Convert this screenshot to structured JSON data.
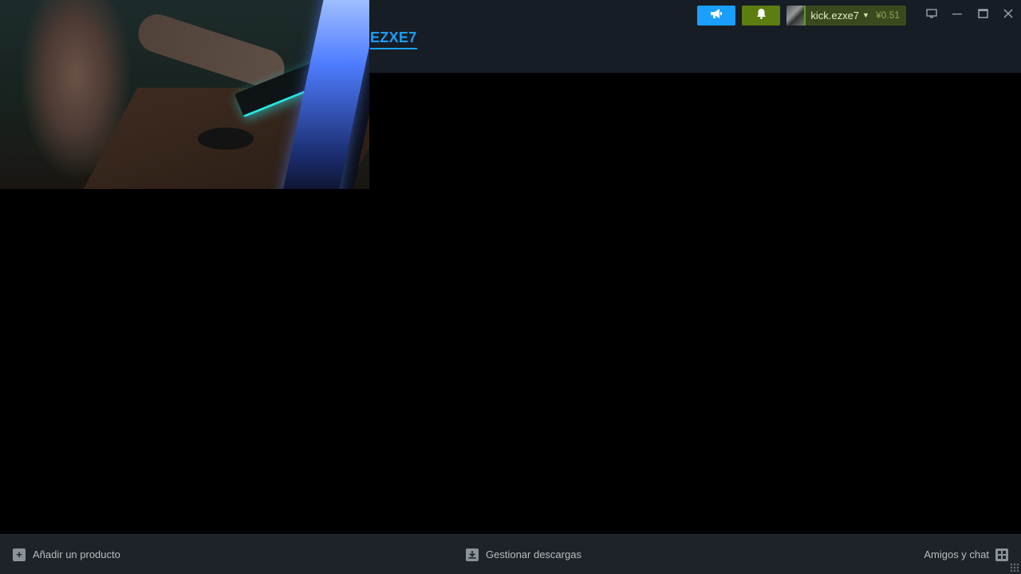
{
  "header": {
    "section_title": "EZXE7"
  },
  "account": {
    "name": "kick.ezxe7",
    "balance": "¥0.51"
  },
  "icons": {
    "announce": "megaphone-icon",
    "notifications": "bell-icon",
    "big_picture": "monitor-icon",
    "minimize": "minimize-icon",
    "maximize": "maximize-icon",
    "close": "close-icon",
    "add": "plus-icon",
    "downloads": "download-icon",
    "friends": "friends-grid-icon"
  },
  "colors": {
    "accent_blue": "#1a9fff",
    "accent_green": "#5c7e10"
  },
  "bottombar": {
    "add_product": "Añadir un producto",
    "manage_downloads": "Gestionar descargas",
    "friends_chat": "Amigos y chat"
  }
}
